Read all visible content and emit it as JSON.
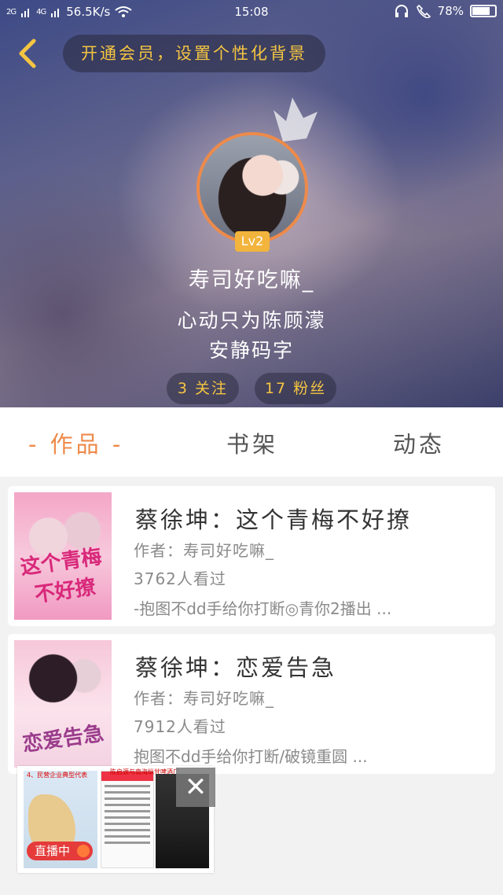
{
  "status_bar": {
    "signal1": "2G",
    "signal2": "4G",
    "net_speed": "56.5K/s",
    "time": "15:08",
    "battery": "78%",
    "battery_level": 0.78
  },
  "header": {
    "vip_banner": "开通会员，设置个性化背景",
    "level_badge": "Lv2",
    "username": "寿司好吃嘛_",
    "bio_line1": "心动只为陈顾濛",
    "bio_line2": "安静码字",
    "following": "3 关注",
    "followers": "17 粉丝"
  },
  "tabs": [
    {
      "label": "- 作品 -",
      "active": true
    },
    {
      "label": "书架",
      "active": false
    },
    {
      "label": "动态",
      "active": false
    }
  ],
  "books": [
    {
      "title": "蔡徐坤：这个青梅不好撩",
      "author": "作者：寿司好吃嘛_",
      "views": "3762人看过",
      "tags": "-抱图不dd手给你打断◎青你2播出 ...",
      "cover_text": "这个青梅不好撩"
    },
    {
      "title": "蔡徐坤：恋爱告急",
      "author": "作者：寿司好吃嘛_",
      "views": "7912人看过",
      "tags": "抱图不dd手给你打断/破镜重圆 ...",
      "cover_text": "恋爱告急"
    }
  ],
  "ad": {
    "headline_left": "4、民营企业典型代表",
    "headline_right": "陈启源与南海纵甘啤酒厂",
    "live_label": "直播中",
    "close_glyph": "✕"
  },
  "colors": {
    "accent": "#ee8a4a",
    "gold": "#f5c542",
    "live": "#e53b3b"
  },
  "icons": [
    "back-arrow-icon",
    "crown-icon",
    "close-icon",
    "wifi-icon",
    "headset-icon",
    "call-icon"
  ]
}
